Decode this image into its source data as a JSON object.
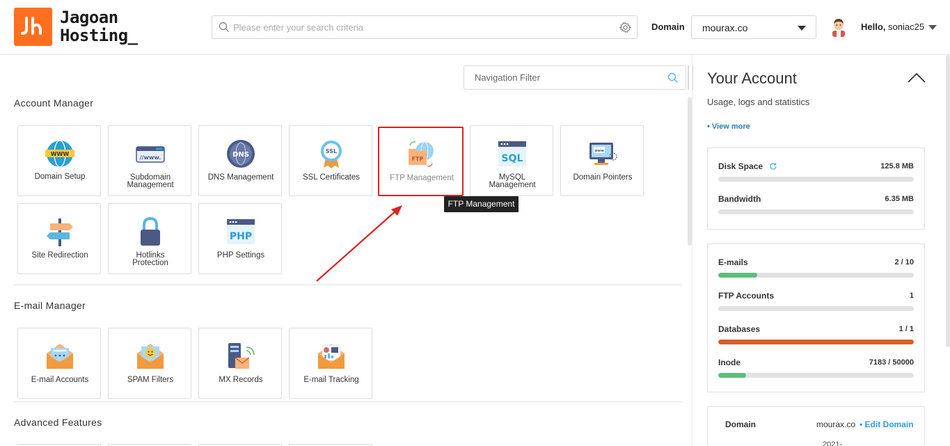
{
  "header": {
    "logo_text": "Jagoan\nHosting_",
    "search_placeholder": "Please enter your search criteria",
    "domain_label": "Domain",
    "domain_value": "mourax.co",
    "hello_prefix": "Hello,",
    "username": "soniac25"
  },
  "nav_filter": {
    "placeholder": "Navigation Filter"
  },
  "sections": {
    "account_manager": "Account Manager",
    "email_manager": "E-mail Manager",
    "advanced_features": "Advanced Features"
  },
  "account_tiles": [
    {
      "label": "Domain Setup",
      "icon": "www-globe-icon"
    },
    {
      "label": "Subdomain\nManagement",
      "icon": "subdomain-icon"
    },
    {
      "label": "DNS Management",
      "icon": "dns-globe-icon"
    },
    {
      "label": "SSL Certificates",
      "icon": "ssl-badge-icon"
    },
    {
      "label": "FTP Management",
      "icon": "ftp-folder-icon"
    },
    {
      "label": "MySQL\nManagement",
      "icon": "sql-icon"
    },
    {
      "label": "Domain Pointers",
      "icon": "monitor-pointer-icon"
    },
    {
      "label": "Site Redirection",
      "icon": "signpost-icon"
    },
    {
      "label": "Hotlinks\nProtection",
      "icon": "padlock-icon"
    },
    {
      "label": "PHP Settings",
      "icon": "php-icon"
    }
  ],
  "email_tiles": [
    {
      "label": "E-mail Accounts",
      "icon": "envelope-icon"
    },
    {
      "label": "SPAM Filters",
      "icon": "envelope-smile-icon"
    },
    {
      "label": "MX Records",
      "icon": "server-signal-icon"
    },
    {
      "label": "E-mail Tracking",
      "icon": "envelope-chart-icon"
    }
  ],
  "tooltip": "FTP Management",
  "account": {
    "title": "Your Account",
    "subtitle": "Usage, logs and statistics",
    "view_more": "• View more",
    "disk_space": {
      "label": "Disk Space",
      "value": "125.8 MB",
      "fraction": 0
    },
    "bandwidth": {
      "label": "Bandwidth",
      "value": "6.35 MB",
      "fraction": 0
    },
    "emails": {
      "label": "E-mails",
      "value": "2 / 10",
      "fraction": 0.2
    },
    "ftp_accounts": {
      "label": "FTP Accounts",
      "value": "1",
      "fraction": 0
    },
    "databases": {
      "label": "Databases",
      "value": "1 / 1",
      "fraction": 1.0
    },
    "inode": {
      "label": "Inode",
      "value": "7183 / 50000",
      "fraction": 0.1437
    },
    "domain_row": {
      "label": "Domain",
      "value": "mourax.co",
      "edit": "• Edit Domain",
      "date": "2021-"
    }
  },
  "colors": {
    "brand_orange": "#ff6f1f",
    "highlight_red": "#e02020",
    "bar_green": "#5cbf7b",
    "bar_orange": "#d4612a",
    "link_blue": "#2a9fd6"
  }
}
